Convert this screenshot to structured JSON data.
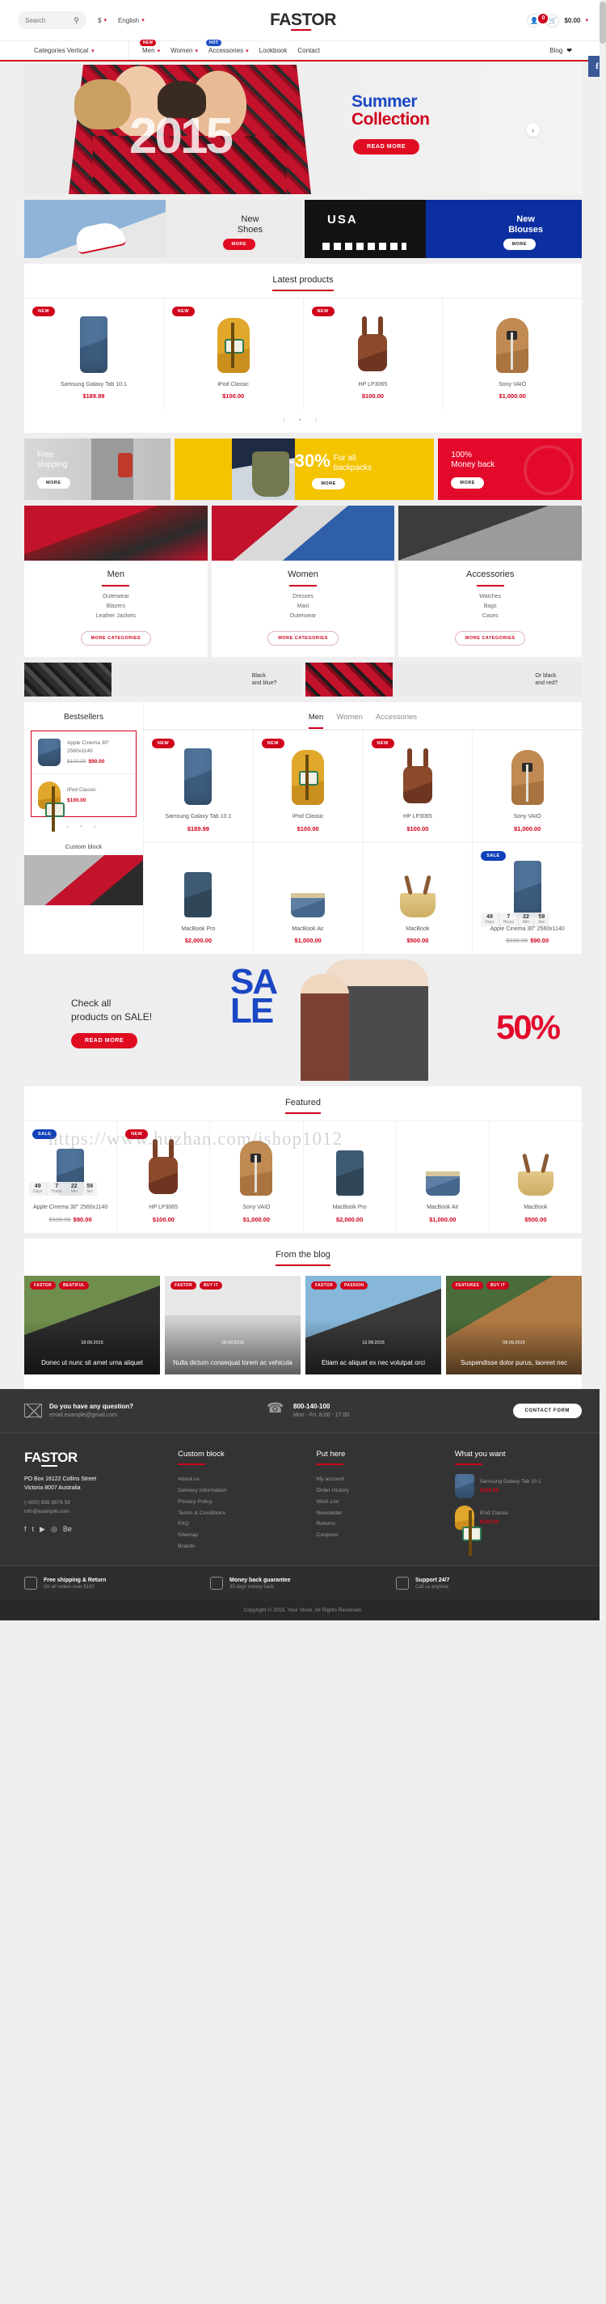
{
  "header": {
    "search_placeholder": "Search",
    "search_icon": "search-icon",
    "currency": "$",
    "language": "English",
    "logo": "FASTOR",
    "account_icon": "user-icon",
    "cart_icon": "basket-icon",
    "cart_count": "0",
    "cart_total": "$0.00"
  },
  "nav": {
    "categories_label": "Categories Vertical",
    "items": [
      {
        "label": "Men",
        "tag": "NEW",
        "caret": true
      },
      {
        "label": "Women",
        "tag": "",
        "caret": true
      },
      {
        "label": "Accessories",
        "tag": "HOT",
        "caret": true
      },
      {
        "label": "Lookbook",
        "tag": "",
        "caret": false
      },
      {
        "label": "Contact",
        "tag": "",
        "caret": false
      }
    ],
    "blog_label": "Blog",
    "facebook_label": "f"
  },
  "hero": {
    "line1": "Summer",
    "line2": "Collection",
    "year": "2015",
    "button": "READ MORE",
    "next_icon": "chevron-right-icon"
  },
  "promos_two": [
    {
      "title_1": "New",
      "title_2": "Shoes",
      "button": "MORE"
    },
    {
      "title_1": "New",
      "title_2": "Blouses",
      "button": "MORE"
    }
  ],
  "latest": {
    "title": "Latest products",
    "products": [
      {
        "name": "Samsung Galaxy Tab 10.1",
        "price": "$189.99",
        "badge": "NEW"
      },
      {
        "name": "iPod Classic",
        "price": "$100.00",
        "badge": "NEW"
      },
      {
        "name": "HP LP3065",
        "price": "$100.00",
        "badge": "NEW"
      },
      {
        "name": "Sony VAIO",
        "price": "$1,000.00",
        "badge": ""
      }
    ],
    "pager": "‹ • ›"
  },
  "promos_three": [
    {
      "title_1": "Free",
      "title_2": "shipping",
      "button": "MORE"
    },
    {
      "number": "-30%",
      "sub_1": "For all",
      "sub_2": "backpacks",
      "button": "MORE"
    },
    {
      "title_1": "100%",
      "title_2": "Money back",
      "button": "MORE"
    }
  ],
  "categories": [
    {
      "title": "Men",
      "links": [
        "Outerwear",
        "Blazers",
        "Leather Jackets"
      ],
      "button": "MORE CATEGORIES"
    },
    {
      "title": "Women",
      "links": [
        "Dresses",
        "Maxi",
        "Outerwear"
      ],
      "button": "MORE CATEGORIES"
    },
    {
      "title": "Accessories",
      "links": [
        "Watches",
        "Bags",
        "Cases"
      ],
      "button": "MORE CATEGORIES"
    }
  ],
  "strips": [
    {
      "line1": "Black",
      "line2": "and blue?"
    },
    {
      "line1": "Or  black",
      "line2": "and red?"
    }
  ],
  "bestsellers": {
    "title": "Bestsellers",
    "items": [
      {
        "name": "Apple Cinema 30\" 2560x1140",
        "old_price": "$100.00",
        "price": "$90.00"
      },
      {
        "name": "iPod Classic",
        "old_price": "",
        "price": "$100.00"
      }
    ],
    "pager": "‹ • ›",
    "tabs": [
      "Men",
      "Women",
      "Accessories"
    ],
    "active_tab": "Men",
    "row1": [
      {
        "name": "Samsung Galaxy Tab 10.1",
        "price": "$189.99",
        "badge": "NEW"
      },
      {
        "name": "iPod Classic",
        "price": "$100.00",
        "badge": "NEW"
      },
      {
        "name": "HP LP3065",
        "price": "$100.00",
        "badge": "NEW"
      },
      {
        "name": "Sony VAIO",
        "price": "$1,000.00",
        "badge": ""
      }
    ],
    "custom_block_title": "Custom block",
    "row2": [
      {
        "name": "MacBook Pro",
        "price": "$2,000.00",
        "badge": ""
      },
      {
        "name": "MacBook Air",
        "price": "$1,000.00",
        "badge": ""
      },
      {
        "name": "MacBook",
        "price": "$500.00",
        "badge": ""
      },
      {
        "name": "Apple Cinema 30\" 2560x1140",
        "old_price": "$100.00",
        "price": "$90.00",
        "badge": "SALE"
      }
    ],
    "countdown": [
      {
        "value": "49",
        "unit": "Days"
      },
      {
        "value": "7",
        "unit": "Hours"
      },
      {
        "value": "22",
        "unit": "Min"
      },
      {
        "value": "59",
        "unit": "Sec"
      }
    ]
  },
  "sale_banner": {
    "heading_1": "Check all",
    "heading_2": "products on SALE!",
    "button": "READ MORE",
    "big_word_1": "SA",
    "big_word_2": "LE",
    "percent": "50%"
  },
  "featured": {
    "title": "Featured",
    "products": [
      {
        "name": "Apple Cinema 30\" 2560x1140",
        "old_price": "$100.00",
        "price": "$90.00",
        "badge": "SALE"
      },
      {
        "name": "HP LP3065",
        "price": "$100.00",
        "badge": "NEW"
      },
      {
        "name": "Sony VAIO",
        "price": "$1,000.00",
        "badge": ""
      },
      {
        "name": "MacBook Pro",
        "price": "$2,000.00",
        "badge": ""
      },
      {
        "name": "MacBook Air",
        "price": "$1,000.00",
        "badge": ""
      },
      {
        "name": "MacBook",
        "price": "$500.00",
        "badge": ""
      }
    ],
    "countdown": [
      {
        "value": "49",
        "unit": "Days"
      },
      {
        "value": "7",
        "unit": "Hours"
      },
      {
        "value": "22",
        "unit": "Min"
      },
      {
        "value": "59",
        "unit": "Sec"
      }
    ]
  },
  "blog": {
    "title": "From the blog",
    "posts": [
      {
        "tags": [
          "FASTOR",
          "BEATIFUL"
        ],
        "date": "18.09.2015",
        "title": "Donec ut nunc sit amet urna aliquet"
      },
      {
        "tags": [
          "FASTOR",
          "BUY IT"
        ],
        "date": "18.09.2015",
        "title": "Nulla dictum consequat lorem ac vehicula"
      },
      {
        "tags": [
          "FASTOR",
          "PASSION"
        ],
        "date": "12.09.2015",
        "title": "Etiam ac aliquet ex nec volutpat orci"
      },
      {
        "tags": [
          "FEATURES",
          "BUY IT"
        ],
        "date": "08.09.2015",
        "title": "Suspendisse dolor purus, laoreet nec"
      }
    ]
  },
  "footer": {
    "contact_bar": {
      "email_icon": "envelope-icon",
      "question": "Do you have any question?",
      "email": "email.example@gmail.com",
      "phone_icon": "phone-icon",
      "phone": "800-140-100",
      "hours": "Mon - Fri. 8:00 - 17:00",
      "button": "CONTACT FORM"
    },
    "brand": {
      "logo": "FASTOR",
      "address_1": "PO Box 16122 Collins Street",
      "address_2": "Victoria 8007 Australia",
      "phone": "(+800) 856 9876 58",
      "email": "info@example.com",
      "social": [
        "f",
        "t",
        "▶",
        "◎",
        "Be"
      ]
    },
    "columns": [
      {
        "title": "Custom block",
        "links": [
          "About us",
          "Delivery Information",
          "Privacy Policy",
          "Terms & Conditions",
          "FAQ",
          "Sitemap",
          "Brands"
        ]
      },
      {
        "title": "Put here",
        "links": [
          "My account",
          "Order History",
          "Wish List",
          "Newsletter",
          "Returns",
          "Coupons"
        ]
      }
    ],
    "products_col": {
      "title": "What you want",
      "items": [
        {
          "name": "Samsung Galaxy Tab 10.1",
          "price": "$189.99"
        },
        {
          "name": "iPod Classic",
          "price": "$100.00"
        }
      ]
    },
    "features": [
      {
        "icon": "truck-icon",
        "title": "Free shipping & Return",
        "sub": "On all orders over $100"
      },
      {
        "icon": "shield-icon",
        "title": "Money back guarantee",
        "sub": "30 days money back"
      },
      {
        "icon": "headset-icon",
        "title": "Support 24/7",
        "sub": "Call us anytime"
      }
    ],
    "copyright": "Copyright © 2015. Your Store. All Rights Reserved."
  },
  "watermark": "https://www.huzhan.com/ishop1012"
}
